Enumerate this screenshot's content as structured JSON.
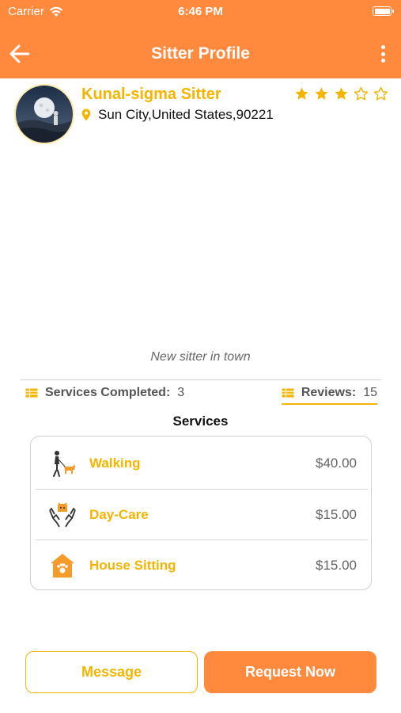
{
  "status_bar": {
    "carrier": "Carrier",
    "time": "6:46 PM"
  },
  "header": {
    "title": "Sitter Profile",
    "back_icon": "arrow-left-icon",
    "menu_icon": "more-vertical-icon"
  },
  "profile": {
    "name": "Kunal-sigma Sitter",
    "location": "Sun City,United States,90221",
    "rating": 3,
    "rating_max": 5,
    "bio": "New sitter in town"
  },
  "stats": {
    "services_completed_label": "Services Completed:",
    "services_completed_value": "3",
    "reviews_label": "Reviews:",
    "reviews_value": "15"
  },
  "services": {
    "title": "Services",
    "items": [
      {
        "name": "Walking",
        "price": "$40.00",
        "icon": "dog-walking-icon"
      },
      {
        "name": "Day-Care",
        "price": "$15.00",
        "icon": "pet-care-hands-icon"
      },
      {
        "name": "House Sitting",
        "price": "$15.00",
        "icon": "pet-house-icon"
      }
    ]
  },
  "actions": {
    "message": "Message",
    "request": "Request Now"
  },
  "colors": {
    "primary": "#ff8a3d",
    "accent": "#f4b400",
    "text": "#222222"
  }
}
